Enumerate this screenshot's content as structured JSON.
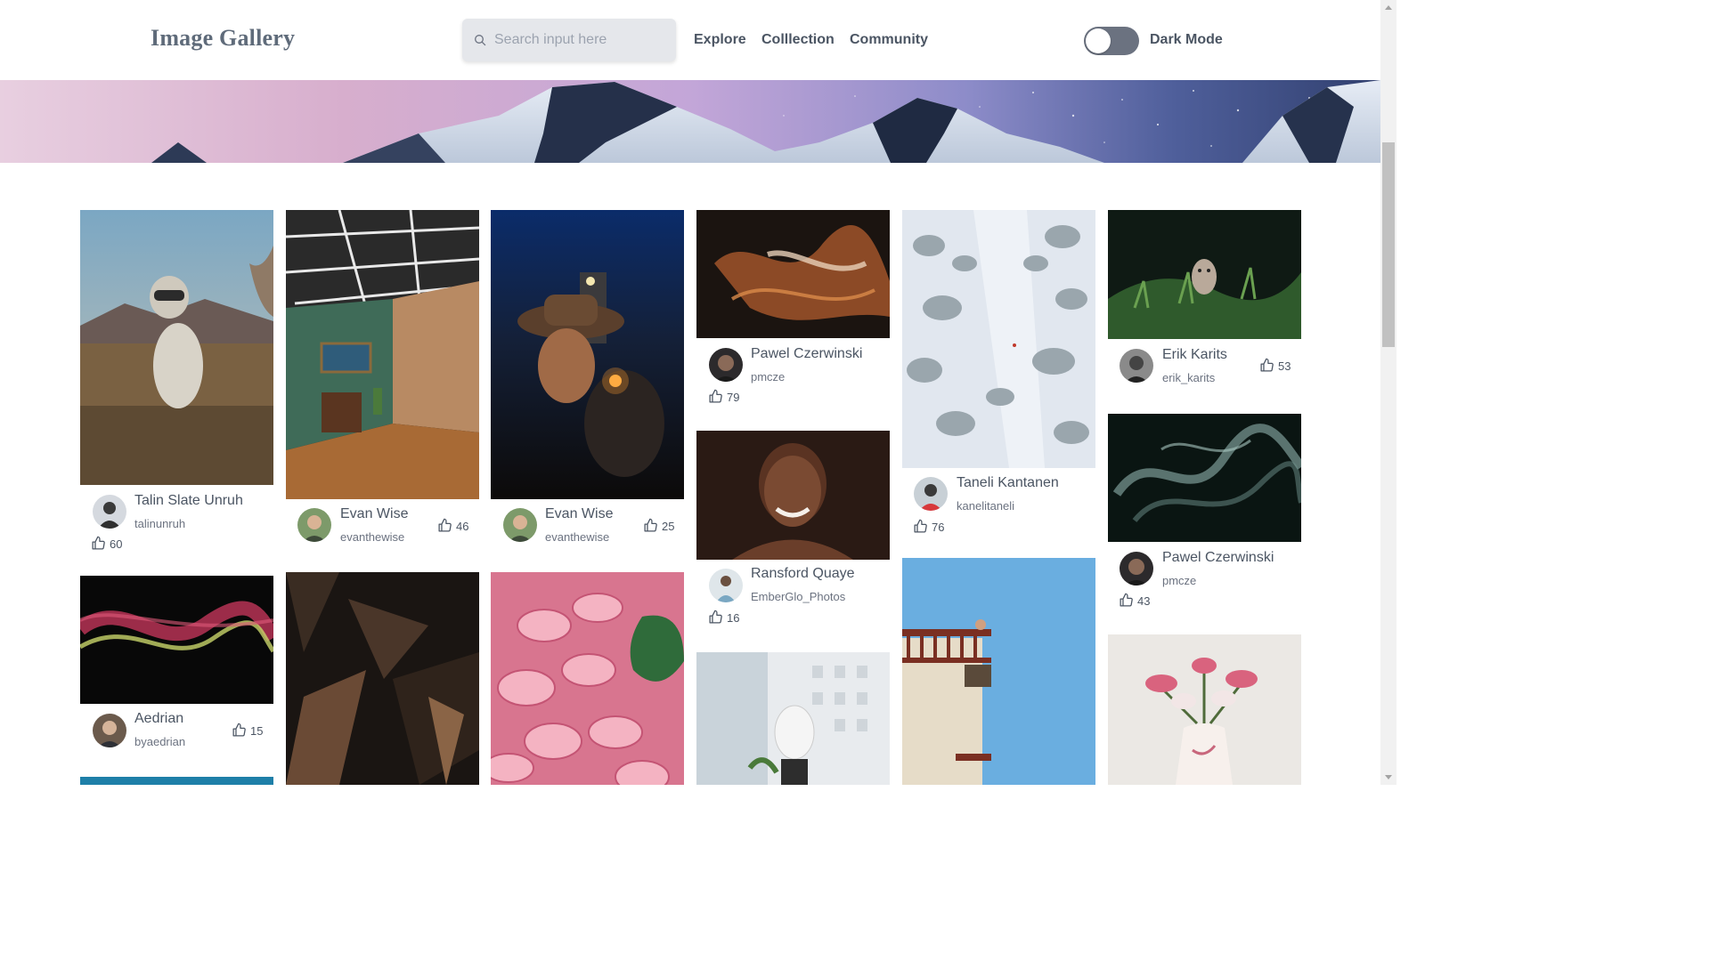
{
  "header": {
    "logo": "Image Gallery",
    "search_placeholder": "Search input here",
    "nav": [
      "Explore",
      "Colllection",
      "Community"
    ],
    "dark_mode_label": "Dark Mode",
    "dark_mode_on": false
  },
  "cards": [
    {
      "name": "Talin Slate Unruh",
      "handle": "talinunruh",
      "likes": "60"
    },
    {
      "name": "Evan Wise",
      "handle": "evanthewise",
      "likes": "46"
    },
    {
      "name": "Evan Wise",
      "handle": "evanthewise",
      "likes": "25"
    },
    {
      "name": "Pawel Czerwinski",
      "handle": "pmcze",
      "likes": "79"
    },
    {
      "name": "Taneli Kantanen",
      "handle": "kanelitaneli",
      "likes": "76"
    },
    {
      "name": "Erik Karits",
      "handle": "erik_karits",
      "likes": "53"
    },
    {
      "name": "Ransford Quaye",
      "handle": "EmberGlo_Photos",
      "likes": "16"
    },
    {
      "name": "Pawel Czerwinski",
      "handle": "pmcze",
      "likes": "43"
    },
    {
      "name": "Aedrian",
      "handle": "byaedrian",
      "likes": "15"
    }
  ],
  "colors": {
    "accent": "#4b5563",
    "search_bg": "#e5e7eb",
    "toggle_track": "#6b7280"
  }
}
